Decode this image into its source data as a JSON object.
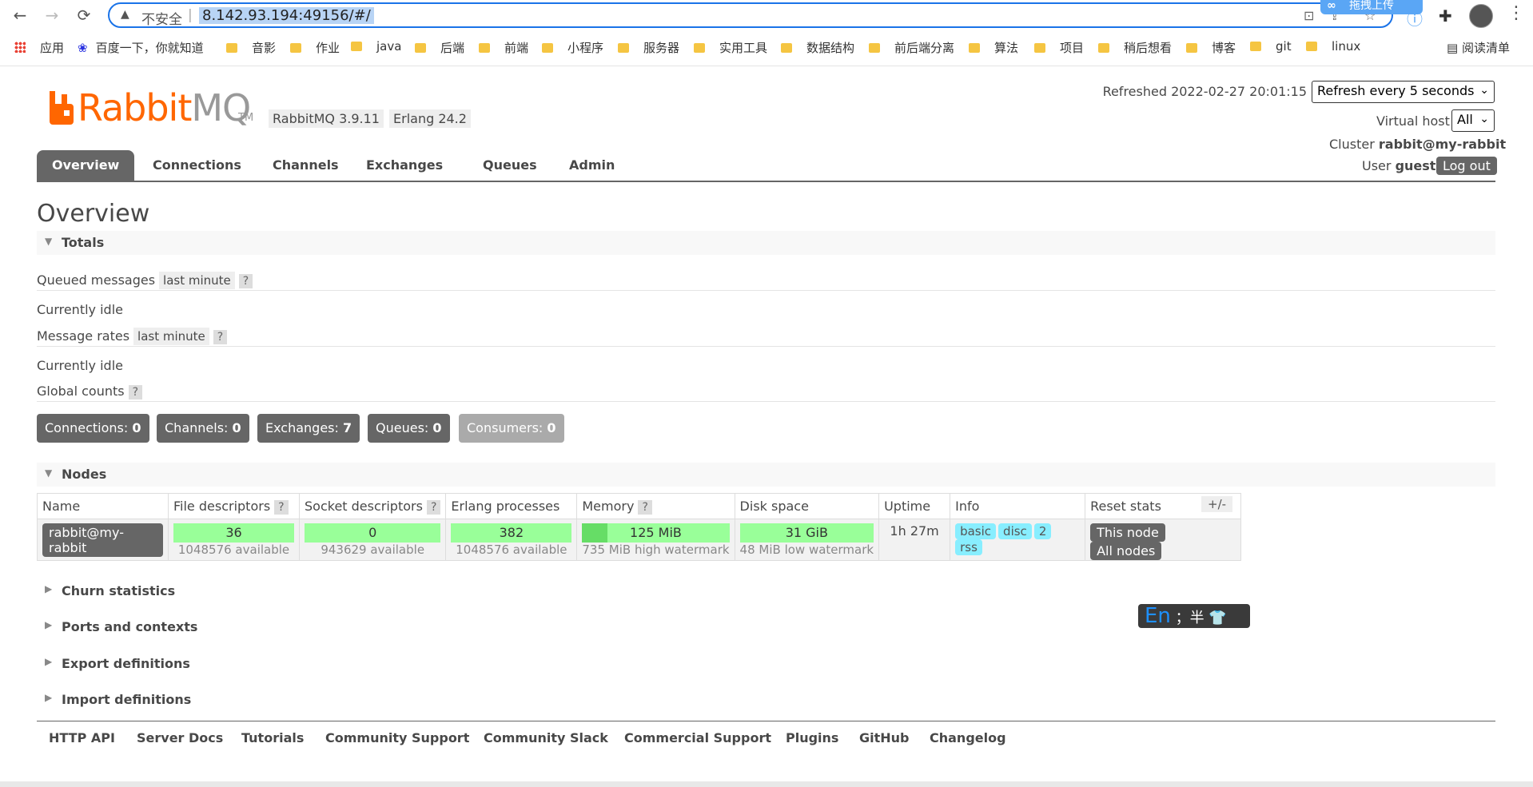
{
  "browser": {
    "insecure_label": "不安全",
    "url": "8.142.93.194:49156/#/",
    "cloud_label": "拖拽上传"
  },
  "bookmarks": [
    {
      "label": "应用"
    },
    {
      "label": "百度一下，你就知道"
    },
    {
      "label": "音影"
    },
    {
      "label": "作业"
    },
    {
      "label": "java"
    },
    {
      "label": "后端"
    },
    {
      "label": "前端"
    },
    {
      "label": "小程序"
    },
    {
      "label": "服务器"
    },
    {
      "label": "实用工具"
    },
    {
      "label": "数据结构"
    },
    {
      "label": "前后端分离"
    },
    {
      "label": "算法"
    },
    {
      "label": "项目"
    },
    {
      "label": "稍后想看"
    },
    {
      "label": "博客"
    },
    {
      "label": "git"
    },
    {
      "label": "linux"
    }
  ],
  "reading_list": "阅读清单",
  "header": {
    "logo_rabbit": "Rabbit",
    "logo_mq": "MQ",
    "logo_tm": "TM",
    "rabbitmq_version": "RabbitMQ 3.9.11",
    "erlang_version": "Erlang 24.2",
    "refreshed": "Refreshed 2022-02-27 20:01:15",
    "refresh_select": "Refresh every 5 seconds",
    "vhost_label": "Virtual host",
    "vhost_value": "All",
    "cluster_label": "Cluster",
    "cluster_value": "rabbit@my-rabbit",
    "user_label": "User",
    "user_value": "guest",
    "logout": "Log out"
  },
  "tabs": [
    {
      "label": "Overview",
      "active": true
    },
    {
      "label": "Connections"
    },
    {
      "label": "Channels"
    },
    {
      "label": "Exchanges"
    },
    {
      "label": "Queues"
    },
    {
      "label": "Admin"
    }
  ],
  "page_title": "Overview",
  "totals": {
    "title": "Totals",
    "queued_messages": "Queued messages",
    "last_minute": "last minute",
    "help": "?",
    "idle1": "Currently idle",
    "message_rates": "Message rates",
    "idle2": "Currently idle",
    "global_counts": "Global counts"
  },
  "counts": [
    {
      "label": "Connections:",
      "value": "0"
    },
    {
      "label": "Channels:",
      "value": "0"
    },
    {
      "label": "Exchanges:",
      "value": "7"
    },
    {
      "label": "Queues:",
      "value": "0"
    },
    {
      "label": "Consumers:",
      "value": "0"
    }
  ],
  "nodes": {
    "title": "Nodes",
    "plus_minus": "+/-",
    "columns": [
      "Name",
      "File descriptors",
      "Socket descriptors",
      "Erlang processes",
      "Memory",
      "Disk space",
      "Uptime",
      "Info",
      "Reset stats"
    ],
    "row": {
      "name": "rabbit@my-rabbit",
      "file_desc": "36",
      "file_desc_sub": "1048576 available",
      "socket_desc": "0",
      "socket_desc_sub": "943629 available",
      "erlang_proc": "382",
      "erlang_proc_sub": "1048576 available",
      "memory": "125 MiB",
      "memory_sub": "735 MiB high watermark",
      "memory_fraction": 0.17,
      "disk": "31 GiB",
      "disk_sub": "48 MiB low watermark",
      "uptime": "1h 27m",
      "info_tags": [
        "basic",
        "disc",
        "2",
        "rss"
      ],
      "reset_this": "This node",
      "reset_all": "All nodes"
    }
  },
  "collapsed_sections": [
    "Churn statistics",
    "Ports and contexts",
    "Export definitions",
    "Import definitions"
  ],
  "ime": {
    "en": "En",
    "rest": "；半"
  },
  "footer": [
    "HTTP API",
    "Server Docs",
    "Tutorials",
    "Community Support",
    "Community Slack",
    "Commercial Support",
    "Plugins",
    "GitHub",
    "Changelog"
  ],
  "colors": {
    "accent": "#ff6600",
    "tab_active": "#666666",
    "green_bar": "#99ff99",
    "info_tag": "#88eeff"
  }
}
